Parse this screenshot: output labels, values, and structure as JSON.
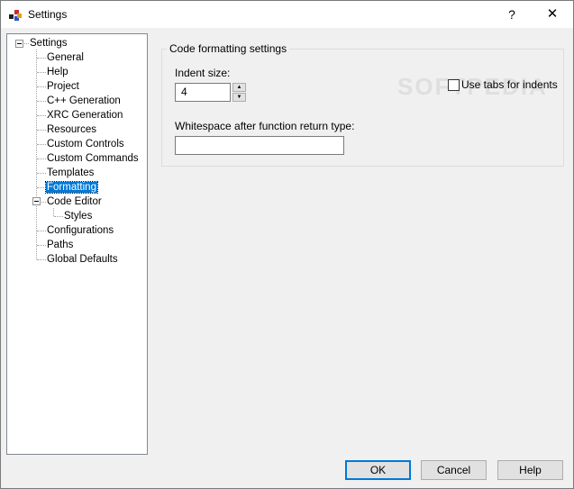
{
  "window": {
    "title": "Settings",
    "help_glyph": "?",
    "close_glyph": "✕"
  },
  "tree": {
    "root": "Settings",
    "items": [
      {
        "label": "General"
      },
      {
        "label": "Help"
      },
      {
        "label": "Project"
      },
      {
        "label": "C++ Generation"
      },
      {
        "label": "XRC Generation"
      },
      {
        "label": "Resources"
      },
      {
        "label": "Custom Controls"
      },
      {
        "label": "Custom Commands"
      },
      {
        "label": "Templates"
      },
      {
        "label": "Formatting",
        "selected": true
      },
      {
        "label": "Code Editor"
      },
      {
        "label": "Styles"
      },
      {
        "label": "Configurations"
      },
      {
        "label": "Paths"
      },
      {
        "label": "Global Defaults"
      }
    ]
  },
  "formatting": {
    "group_title": "Code formatting settings",
    "indent_label": "Indent size:",
    "indent_value": "4",
    "use_tabs_label": "Use tabs for indents",
    "use_tabs_checked": false,
    "whitespace_label": "Whitespace after function return type:",
    "whitespace_value": ""
  },
  "buttons": {
    "ok": "OK",
    "cancel": "Cancel",
    "help": "Help"
  },
  "watermark": "SOFTPEDIA",
  "colors": {
    "selection": "#0078d7",
    "dialog_bg": "#f0f0f0"
  }
}
